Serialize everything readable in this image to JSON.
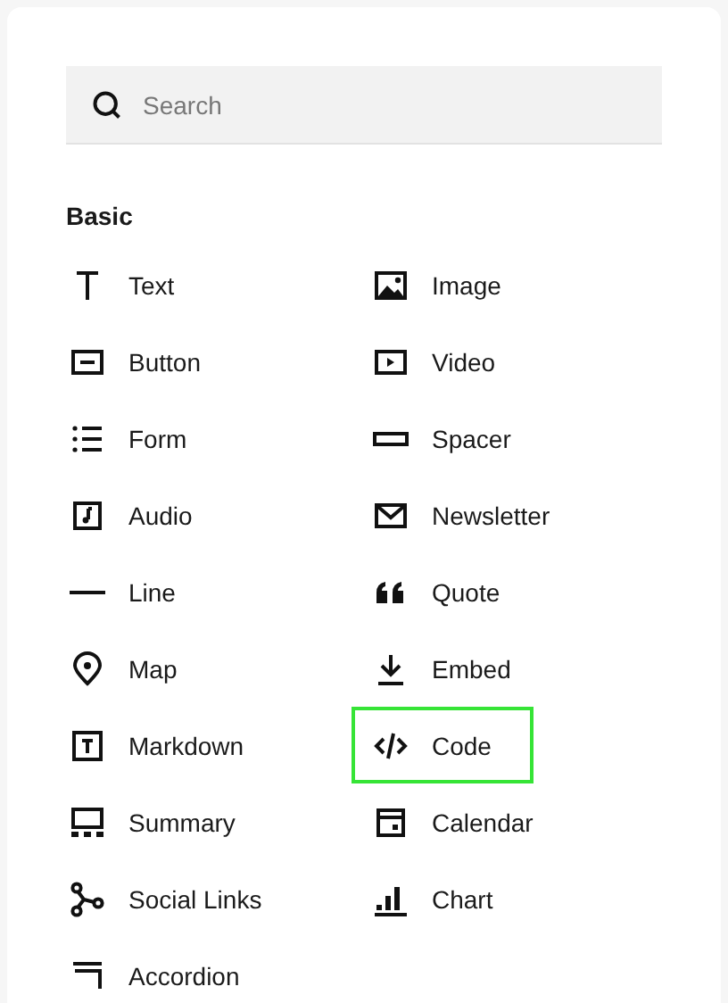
{
  "search": {
    "placeholder": "Search"
  },
  "section": "Basic",
  "items": [
    {
      "label": "Text",
      "selected": false
    },
    {
      "label": "Image",
      "selected": false
    },
    {
      "label": "Button",
      "selected": false
    },
    {
      "label": "Video",
      "selected": false
    },
    {
      "label": "Form",
      "selected": false
    },
    {
      "label": "Spacer",
      "selected": false
    },
    {
      "label": "Audio",
      "selected": false
    },
    {
      "label": "Newsletter",
      "selected": false
    },
    {
      "label": "Line",
      "selected": false
    },
    {
      "label": "Quote",
      "selected": false
    },
    {
      "label": "Map",
      "selected": false
    },
    {
      "label": "Embed",
      "selected": false
    },
    {
      "label": "Markdown",
      "selected": false
    },
    {
      "label": "Code",
      "selected": true
    },
    {
      "label": "Summary",
      "selected": false
    },
    {
      "label": "Calendar",
      "selected": false
    },
    {
      "label": "Social Links",
      "selected": false
    },
    {
      "label": "Chart",
      "selected": false
    },
    {
      "label": "Accordion",
      "selected": false
    }
  ]
}
